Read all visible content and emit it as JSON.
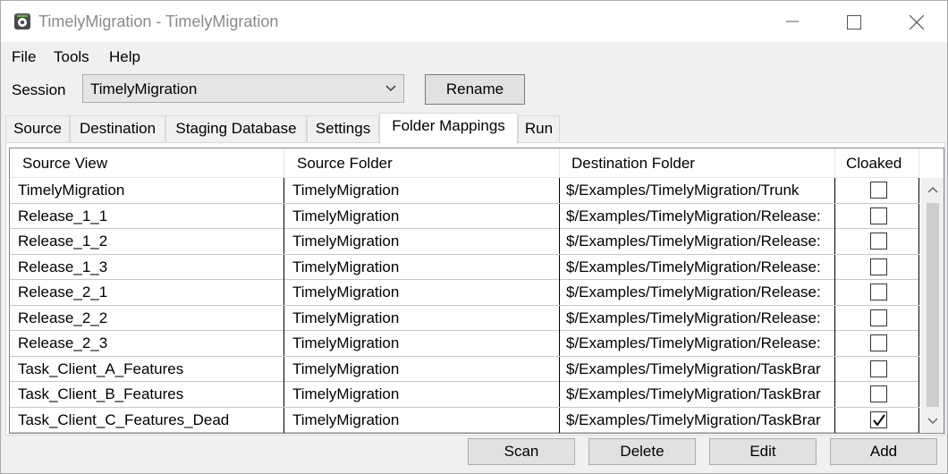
{
  "window": {
    "title": "TimelyMigration - TimelyMigration"
  },
  "menu": [
    "File",
    "Tools",
    "Help"
  ],
  "session": {
    "label": "Session",
    "value": "TimelyMigration",
    "rename_label": "Rename"
  },
  "tabs": [
    {
      "label": "Source",
      "active": false
    },
    {
      "label": "Destination",
      "active": false
    },
    {
      "label": "Staging Database",
      "active": false
    },
    {
      "label": "Settings",
      "active": false
    },
    {
      "label": "Folder Mappings",
      "active": true
    },
    {
      "label": "Run",
      "active": false
    }
  ],
  "grid": {
    "columns": [
      "Source View",
      "Source Folder",
      "Destination Folder",
      "Cloaked"
    ],
    "rows": [
      {
        "source_view": "TimelyMigration",
        "source_folder": "TimelyMigration",
        "destination_folder": "$/Examples/TimelyMigration/Trunk",
        "cloaked": false
      },
      {
        "source_view": "Release_1_1",
        "source_folder": "TimelyMigration",
        "destination_folder": "$/Examples/TimelyMigration/Release:",
        "cloaked": false
      },
      {
        "source_view": "Release_1_2",
        "source_folder": "TimelyMigration",
        "destination_folder": "$/Examples/TimelyMigration/Release:",
        "cloaked": false
      },
      {
        "source_view": "Release_1_3",
        "source_folder": "TimelyMigration",
        "destination_folder": "$/Examples/TimelyMigration/Release:",
        "cloaked": false
      },
      {
        "source_view": "Release_2_1",
        "source_folder": "TimelyMigration",
        "destination_folder": "$/Examples/TimelyMigration/Release:",
        "cloaked": false
      },
      {
        "source_view": "Release_2_2",
        "source_folder": "TimelyMigration",
        "destination_folder": "$/Examples/TimelyMigration/Release:",
        "cloaked": false
      },
      {
        "source_view": "Release_2_3",
        "source_folder": "TimelyMigration",
        "destination_folder": "$/Examples/TimelyMigration/Release:",
        "cloaked": false
      },
      {
        "source_view": "Task_Client_A_Features",
        "source_folder": "TimelyMigration",
        "destination_folder": "$/Examples/TimelyMigration/TaskBrar",
        "cloaked": false
      },
      {
        "source_view": "Task_Client_B_Features",
        "source_folder": "TimelyMigration",
        "destination_folder": "$/Examples/TimelyMigration/TaskBrar",
        "cloaked": false
      },
      {
        "source_view": "Task_Client_C_Features_Dead",
        "source_folder": "TimelyMigration",
        "destination_folder": "$/Examples/TimelyMigration/TaskBrar",
        "cloaked": true
      }
    ]
  },
  "actions": {
    "scan": "Scan",
    "delete": "Delete",
    "edit": "Edit",
    "add": "Add"
  }
}
